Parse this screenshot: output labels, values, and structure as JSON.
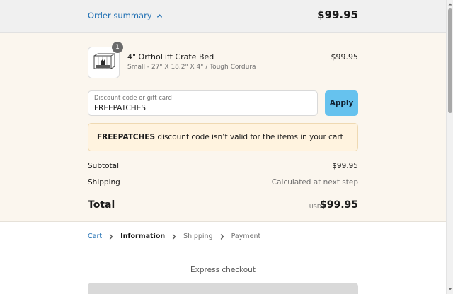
{
  "summary": {
    "toggle_label": "Order summary",
    "total": "$99.95"
  },
  "product": {
    "quantity": "1",
    "name": "4\" OrthoLift Crate Bed",
    "variant": "Small - 27\" X 18.2\" X 4\" / Tough Cordura",
    "price": "$99.95"
  },
  "discount": {
    "label": "Discount code or gift card",
    "value": "FREEPATCHES",
    "apply_label": "Apply"
  },
  "alert": {
    "code": "FREEPATCHES",
    "message": " discount code isn’t valid for the items in your cart"
  },
  "totals": {
    "subtotal_label": "Subtotal",
    "subtotal_value": "$99.95",
    "shipping_label": "Shipping",
    "shipping_value": "Calculated at next step",
    "total_label": "Total",
    "currency": "USD",
    "total_value": "$99.95"
  },
  "breadcrumb": {
    "items": [
      "Cart",
      "Information",
      "Shipping",
      "Payment"
    ]
  },
  "express": {
    "title": "Express checkout"
  },
  "colors": {
    "link": "#1f6fb3",
    "apply_button": "#66c2ee",
    "alert_background": "#fff3df",
    "summary_background": "#fbf6ee"
  },
  "icons": [
    "chevron-up-icon",
    "chevron-right-icon",
    "crate-bed-thumbnail"
  ]
}
